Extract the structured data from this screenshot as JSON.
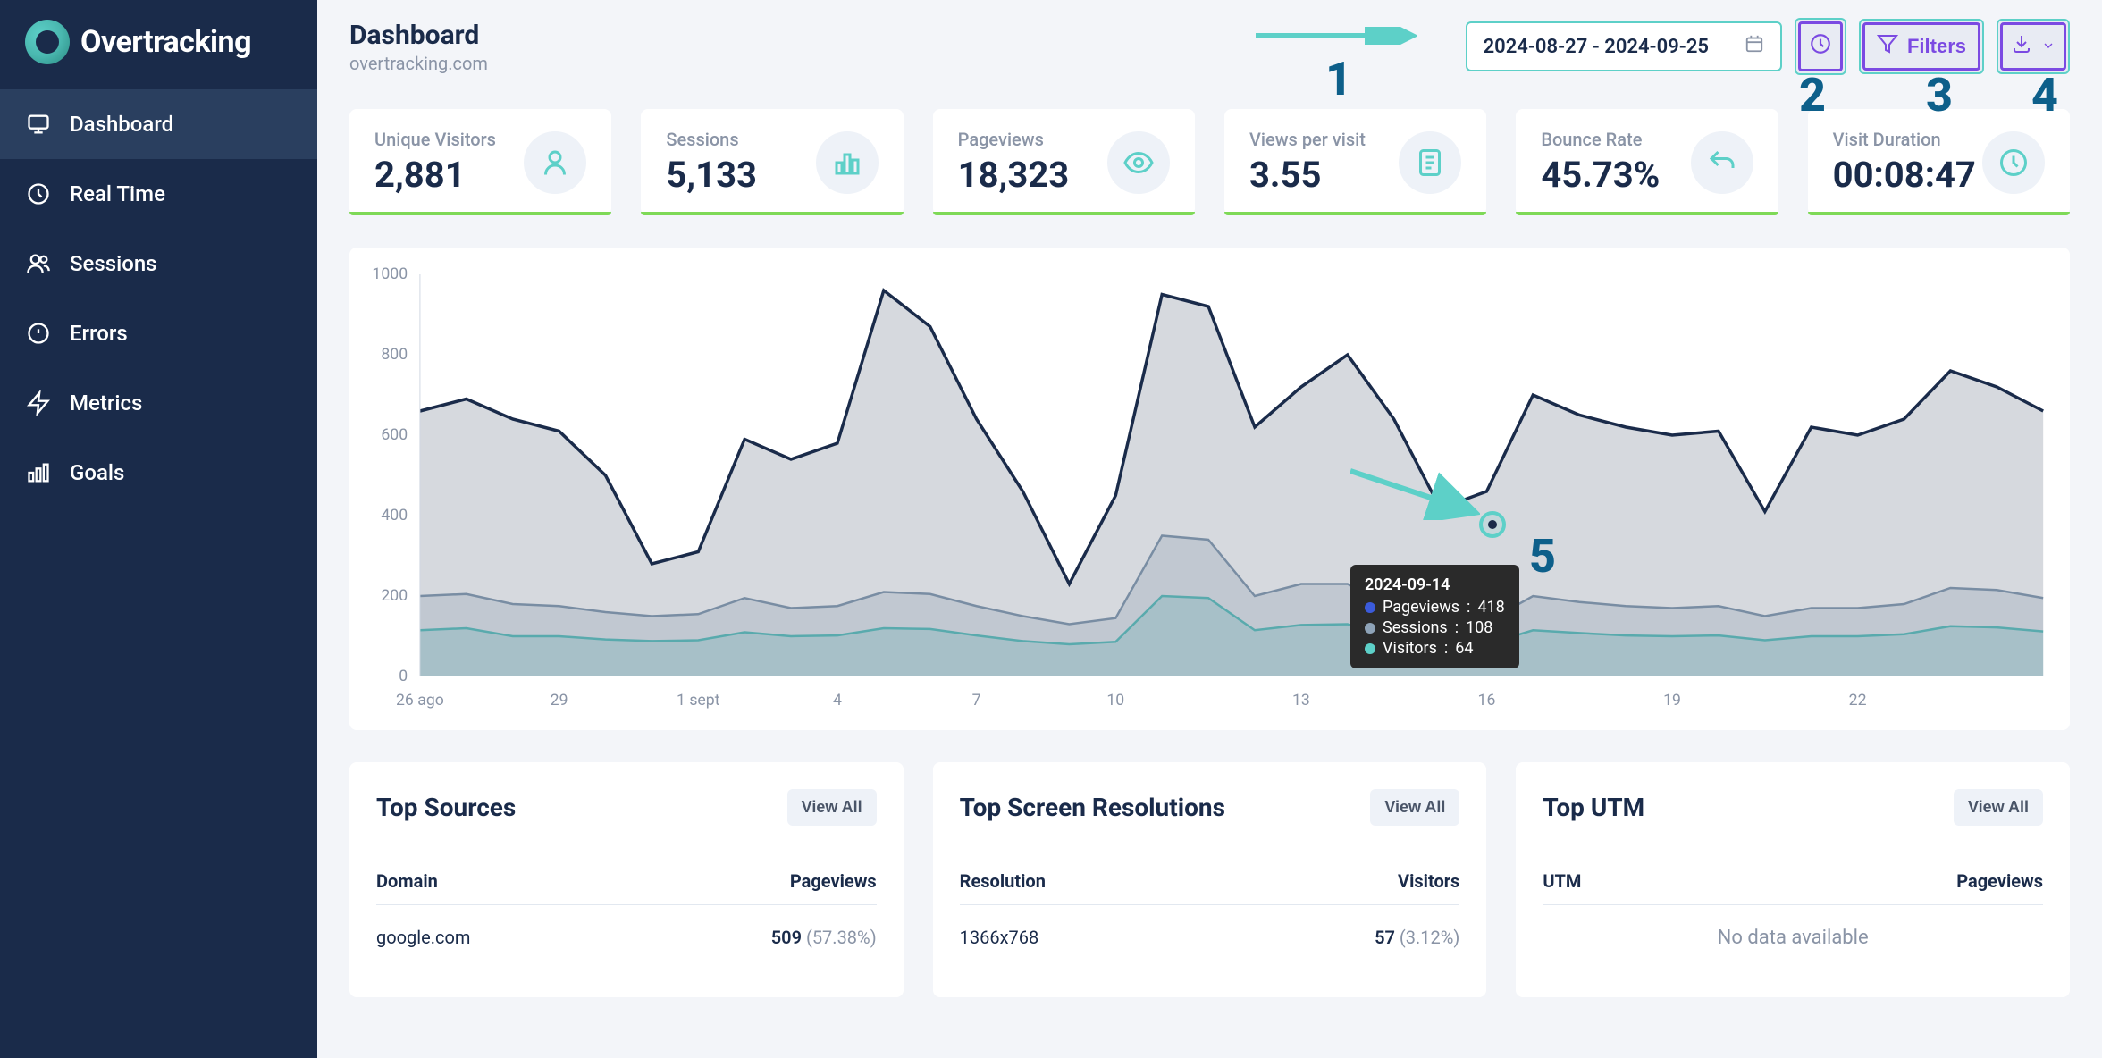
{
  "brand": "Overtracking",
  "sidebar": {
    "items": [
      {
        "label": "Dashboard",
        "icon": "monitor",
        "active": true
      },
      {
        "label": "Real Time",
        "icon": "clock",
        "active": false
      },
      {
        "label": "Sessions",
        "icon": "users",
        "active": false
      },
      {
        "label": "Errors",
        "icon": "alert",
        "active": false
      },
      {
        "label": "Metrics",
        "icon": "bolt",
        "active": false
      },
      {
        "label": "Goals",
        "icon": "bars",
        "active": false
      }
    ]
  },
  "header": {
    "title": "Dashboard",
    "subtitle": "overtracking.com",
    "date_range": "2024-08-27 - 2024-09-25",
    "filters_label": "Filters"
  },
  "annotations": {
    "n1": "1",
    "n2": "2",
    "n3": "3",
    "n4": "4",
    "n5": "5"
  },
  "stats": [
    {
      "label": "Unique Visitors",
      "value": "2,881",
      "icon": "user"
    },
    {
      "label": "Sessions",
      "value": "5,133",
      "icon": "bars"
    },
    {
      "label": "Pageviews",
      "value": "18,323",
      "icon": "eye"
    },
    {
      "label": "Views per visit",
      "value": "3.55",
      "icon": "page"
    },
    {
      "label": "Bounce Rate",
      "value": "45.73%",
      "icon": "undo"
    },
    {
      "label": "Visit Duration",
      "value": "00:08:47",
      "icon": "clock"
    }
  ],
  "chart_data": {
    "type": "line",
    "title": "",
    "xlabel": "",
    "ylabel": "",
    "ylim": [
      0,
      1000
    ],
    "y_ticks": [
      0,
      200,
      400,
      600,
      800,
      1000
    ],
    "x_labels": [
      "26 ago",
      "29",
      "1 sept",
      "4",
      "7",
      "10",
      "13",
      "16",
      "19",
      "22"
    ],
    "x_dates": [
      "2024-08-26",
      "2024-08-27",
      "2024-08-28",
      "2024-08-29",
      "2024-08-30",
      "2024-08-31",
      "2024-09-01",
      "2024-09-02",
      "2024-09-03",
      "2024-09-04",
      "2024-09-05",
      "2024-09-06",
      "2024-09-07",
      "2024-09-08",
      "2024-09-09",
      "2024-09-10",
      "2024-09-11",
      "2024-09-12",
      "2024-09-13",
      "2024-09-14",
      "2024-09-15",
      "2024-09-16",
      "2024-09-17",
      "2024-09-18",
      "2024-09-19",
      "2024-09-20",
      "2024-09-21",
      "2024-09-22",
      "2024-09-23",
      "2024-09-24",
      "2024-09-25"
    ],
    "series": [
      {
        "name": "Pageviews",
        "color": "#1a2b4a",
        "values": [
          660,
          690,
          640,
          610,
          500,
          280,
          310,
          590,
          540,
          580,
          960,
          870,
          640,
          460,
          230,
          450,
          950,
          920,
          620,
          720,
          800,
          640,
          418,
          460,
          700,
          650,
          620,
          600,
          610,
          410,
          620,
          600,
          640,
          760,
          720,
          660
        ]
      },
      {
        "name": "Sessions",
        "color": "#8ea3b8",
        "values": [
          200,
          205,
          180,
          175,
          160,
          150,
          155,
          195,
          170,
          175,
          210,
          205,
          175,
          150,
          130,
          145,
          350,
          340,
          200,
          230,
          230,
          175,
          108,
          135,
          200,
          185,
          175,
          170,
          175,
          150,
          170,
          170,
          180,
          220,
          215,
          195
        ]
      },
      {
        "name": "Visitors",
        "color": "#5dd0c8",
        "values": [
          115,
          120,
          100,
          100,
          92,
          88,
          90,
          110,
          100,
          102,
          120,
          118,
          102,
          88,
          80,
          86,
          200,
          195,
          115,
          128,
          130,
          100,
          64,
          80,
          115,
          108,
          102,
          100,
          102,
          90,
          100,
          100,
          105,
          125,
          122,
          112
        ]
      }
    ],
    "tooltip": {
      "date": "2024-09-14",
      "rows": [
        {
          "label": "Pageviews",
          "value": 418,
          "color": "#3b5bdb"
        },
        {
          "label": "Sessions",
          "value": 108,
          "color": "#8ea3b8"
        },
        {
          "label": "Visitors",
          "value": 64,
          "color": "#5dd0c8"
        }
      ]
    }
  },
  "panels": {
    "sources": {
      "title": "Top Sources",
      "view_all": "View All",
      "col1": "Domain",
      "col2": "Pageviews",
      "rows": [
        {
          "domain": "google.com",
          "value": "509",
          "pct": "(57.38%)"
        }
      ]
    },
    "resolutions": {
      "title": "Top Screen Resolutions",
      "view_all": "View All",
      "col1": "Resolution",
      "col2": "Visitors",
      "rows": [
        {
          "resolution": "1366x768",
          "value": "57",
          "pct": "(3.12%)"
        }
      ]
    },
    "utm": {
      "title": "Top UTM",
      "view_all": "View All",
      "col1": "UTM",
      "col2": "Pageviews",
      "empty": "No data available"
    }
  }
}
